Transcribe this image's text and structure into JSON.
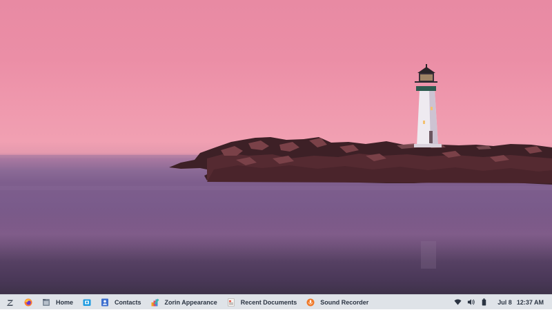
{
  "desktop": {
    "wallpaper": "lighthouse-at-dusk",
    "sky_color": "#ee95ab",
    "sea_color": "#7a5b8b"
  },
  "taskbar": {
    "background": "#dfe3e8",
    "menu_icon": "zorin-logo-icon",
    "items": [
      {
        "icon": "firefox-icon",
        "label": ""
      },
      {
        "icon": "files-icon",
        "label": "Home"
      },
      {
        "icon": "screenshot-icon",
        "label": ""
      },
      {
        "icon": "contacts-icon",
        "label": "Contacts"
      },
      {
        "icon": "appearance-icon",
        "label": "Zorin Appearance"
      },
      {
        "icon": "documents-icon",
        "label": "Recent Documents"
      },
      {
        "icon": "sound-recorder-icon",
        "label": "Sound Recorder"
      }
    ],
    "tray": {
      "icons": [
        "wifi-icon",
        "volume-icon",
        "battery-icon"
      ]
    },
    "clock": {
      "date": "Jul 8",
      "time": "12:37 AM"
    }
  }
}
